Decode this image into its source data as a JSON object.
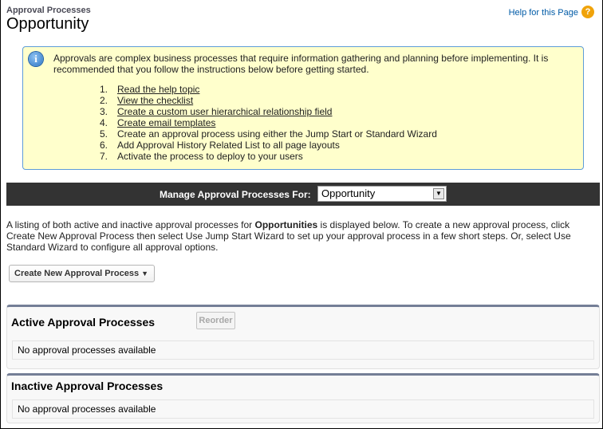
{
  "header": {
    "breadcrumb": "Approval Processes",
    "title": "Opportunity",
    "help_link": "Help for this Page",
    "help_icon": "?"
  },
  "info": {
    "icon": "i",
    "intro": "Approvals are complex business processes that require information gathering and planning before implementing. It is recommended that you follow the instructions below before getting started.",
    "steps": [
      {
        "num": "1.",
        "text": "Read the help topic",
        "link": true
      },
      {
        "num": "2.",
        "text": "View the checklist",
        "link": true
      },
      {
        "num": "3.",
        "text": "Create a custom user hierarchical relationship field",
        "link": true
      },
      {
        "num": "4.",
        "text": "Create email templates",
        "link": true
      },
      {
        "num": "5.",
        "text": "Create an approval process using either the Jump Start or Standard Wizard",
        "link": false
      },
      {
        "num": "6.",
        "text": "Add Approval History Related List to all page layouts",
        "link": false
      },
      {
        "num": "7.",
        "text": "Activate the process to deploy to your users",
        "link": false
      }
    ]
  },
  "manage": {
    "label": "Manage Approval Processes For:",
    "selected": "Opportunity",
    "arrow": "▼"
  },
  "description": {
    "before": "A listing of both active and inactive approval processes for ",
    "bold": "Opportunities",
    "after": " is displayed below. To create a new approval process, click Create New Approval Process then select Use Jump Start Wizard to set up your approval process in a few short steps. Or, select Use Standard Wizard to configure all approval options."
  },
  "create_button": {
    "label": "Create New Approval Process",
    "caret": "▼"
  },
  "active_section": {
    "title": "Active Approval Processes",
    "reorder_label": "Reorder",
    "empty_text": "No approval processes available"
  },
  "inactive_section": {
    "title": "Inactive Approval Processes",
    "empty_text": "No approval processes available"
  }
}
